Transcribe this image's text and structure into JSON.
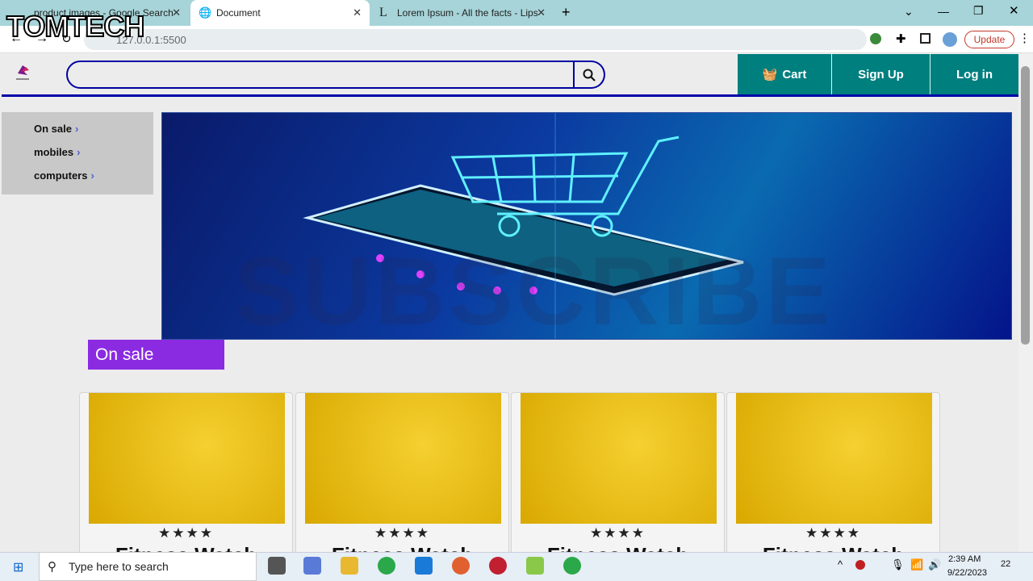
{
  "browser": {
    "tabs": [
      {
        "label": "product images - Google Search"
      },
      {
        "label": "Document"
      },
      {
        "label": "Lorem Ipsum - All the facts - Lips"
      }
    ],
    "url": "127.0.0.1:5500",
    "update_label": "Update"
  },
  "header": {
    "search_placeholder": "",
    "cart_label": "Cart",
    "signup_label": "Sign Up",
    "login_label": "Log in"
  },
  "sidebar": {
    "items": [
      {
        "label": "On sale"
      },
      {
        "label": "mobiles"
      },
      {
        "label": "computers"
      }
    ]
  },
  "section_title": "On sale",
  "products": [
    {
      "title": "Fitness Watch",
      "rating": 4
    },
    {
      "title": "Fitness Watch",
      "rating": 4
    },
    {
      "title": "Fitness Watch",
      "rating": 4
    },
    {
      "title": "Fitness Watch",
      "rating": 4
    }
  ],
  "stars": "★★★★",
  "taskbar": {
    "search_placeholder": "Type here to search",
    "time": "2:39 AM",
    "date": "9/22/2023",
    "notif_count": "22"
  },
  "watermark": "TOMTECH",
  "overlay_text": "SUBSCRIBE",
  "colors": {
    "teal": "#007f7f",
    "purple": "#8a2be2",
    "navy": "#0000a8"
  }
}
